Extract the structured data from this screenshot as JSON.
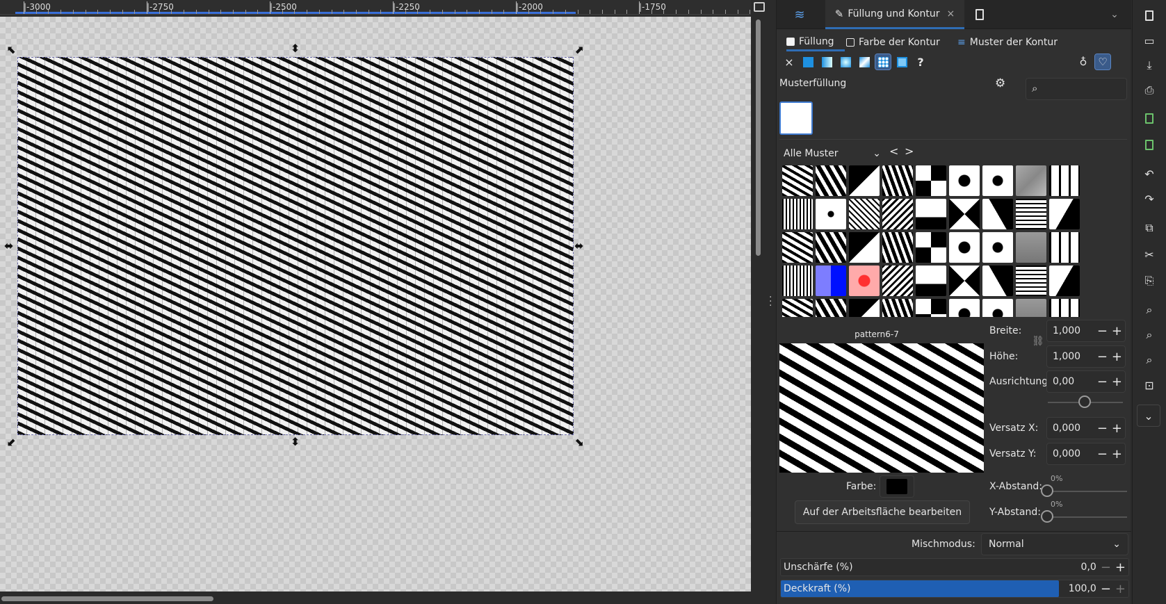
{
  "ruler": {
    "labels": [
      "|-3000",
      "|-2750",
      "|-2500",
      "|-2250",
      "|-2000",
      "|-1750"
    ]
  },
  "dock": {
    "tabs": [
      {
        "name": "layers-objects-tab",
        "label": ""
      },
      {
        "name": "fill-stroke-tab",
        "label": "Füllung und Kontur"
      },
      {
        "name": "export-tab",
        "label": ""
      }
    ],
    "close_glyph": "×",
    "subtabs": {
      "fill": "Füllung",
      "stroke_paint": "Farbe der Kontur",
      "stroke_style": "Muster der Kontur"
    },
    "fill_types": {
      "none": "×",
      "unset": "?"
    },
    "pattern_heading": "Musterfüllung",
    "collection": "Alle Muster",
    "nav_prev": "<",
    "nav_next": ">",
    "pattern_name": "pattern6-7",
    "properties": {
      "width_label": "Breite:",
      "width_value": "1,000",
      "height_label": "Höhe:",
      "height_value": "1,000",
      "orientation_label": "Ausrichtung",
      "orientation_value": "0,00",
      "offset_x_label": "Versatz X:",
      "offset_x_value": "0,000",
      "offset_y_label": "Versatz Y:",
      "offset_y_value": "0,000",
      "gap_x_label": "X-Abstand:",
      "gap_x_value": "0%",
      "gap_y_label": "Y-Abstand:",
      "gap_y_value": "0%",
      "color_label": "Farbe:",
      "edit_button": "Auf der Arbeitsfläche bearbeiten"
    },
    "blend": {
      "label": "Mischmodus:",
      "value": "Normal"
    },
    "blur": {
      "label": "Unschärfe (%)",
      "value": "0,0"
    },
    "opacity": {
      "label": "Deckkraft (%)",
      "value": "100,0",
      "fraction": 1.0
    },
    "spin_minus": "−",
    "spin_plus": "+",
    "colors": {
      "accent": "#2f6db5",
      "fill_blue": "#1e90e0",
      "opacity_fill": "#1f5fb3"
    }
  },
  "toolbar": {
    "icons": [
      "new-document-icon",
      "open-icon",
      "save-icon",
      "print-icon",
      "import-icon",
      "export-icon",
      "undo-icon",
      "redo-icon",
      "duplicate-icon",
      "cut-icon",
      "paste-icon",
      "zoom-selection-icon",
      "zoom-drawing-icon",
      "zoom-page-icon",
      "zoom-center-icon",
      "more-icon"
    ]
  }
}
